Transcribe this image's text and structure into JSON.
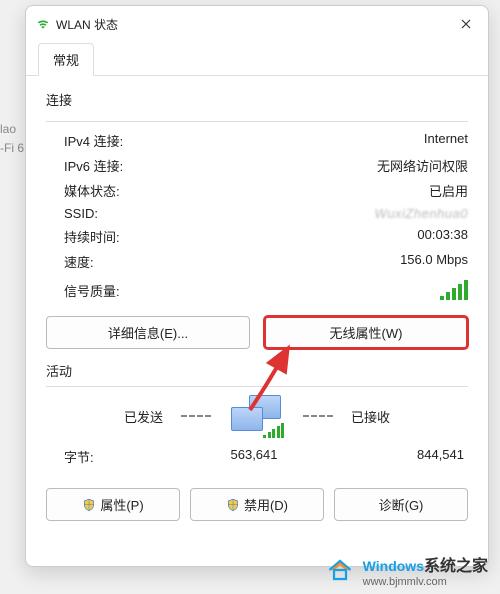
{
  "bg": {
    "line1": "lao",
    "line2": "-Fi 6"
  },
  "titlebar": {
    "title": "WLAN 状态"
  },
  "tabs": {
    "general": "常规"
  },
  "connection": {
    "heading": "连接",
    "rows": {
      "ipv4_label": "IPv4 连接:",
      "ipv4_value": "Internet",
      "ipv6_label": "IPv6 连接:",
      "ipv6_value": "无网络访问权限",
      "media_label": "媒体状态:",
      "media_value": "已启用",
      "ssid_label": "SSID:",
      "ssid_value": "WuxiZhenhua0",
      "duration_label": "持续时间:",
      "duration_value": "00:03:38",
      "speed_label": "速度:",
      "speed_value": "156.0 Mbps",
      "signal_label": "信号质量:"
    }
  },
  "buttons": {
    "details": "详细信息(E)...",
    "wireless_props": "无线属性(W)",
    "properties": "属性(P)",
    "disable": "禁用(D)",
    "diagnose": "诊断(G)"
  },
  "activity": {
    "heading": "活动",
    "sent_label": "已发送",
    "recv_label": "已接收",
    "bytes_label": "字节:",
    "sent_value": "563,641",
    "recv_value": "844,541"
  },
  "watermark": {
    "brand_en": "Windows",
    "brand_cn": "系统之家",
    "url": "www.bjmmlv.com"
  }
}
